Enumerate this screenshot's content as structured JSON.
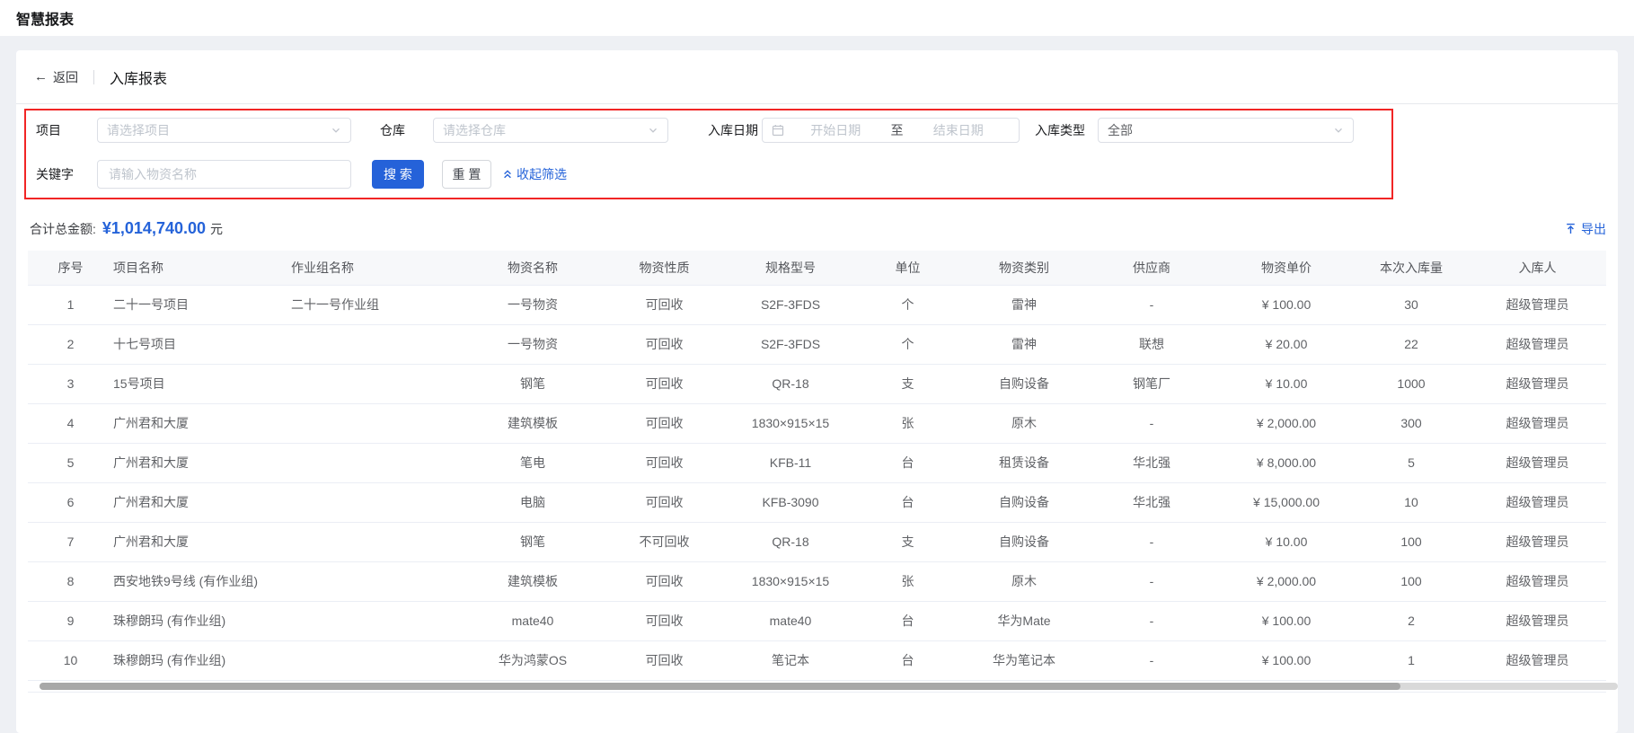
{
  "app": {
    "title": "智慧报表"
  },
  "page": {
    "back_label": "返回",
    "title": "入库报表"
  },
  "icons": {
    "back_arrow": "←"
  },
  "filters": {
    "project": {
      "label": "项目",
      "placeholder": "请选择项目"
    },
    "warehouse": {
      "label": "仓库",
      "placeholder": "请选择仓库"
    },
    "date": {
      "label": "入库日期",
      "start_placeholder": "开始日期",
      "separator": "至",
      "end_placeholder": "结束日期"
    },
    "type": {
      "label": "入库类型",
      "value": "全部"
    },
    "keyword": {
      "label": "关键字",
      "placeholder": "请输入物资名称"
    },
    "search_label": "搜 索",
    "reset_label": "重 置",
    "collapse_label": "收起筛选"
  },
  "summary": {
    "label": "合计总金额:",
    "amount": "¥1,014,740.00",
    "unit": "元",
    "export_label": "导出"
  },
  "colors": {
    "accent": "#2563d9",
    "highlight_border": "#f12525"
  },
  "table": {
    "columns": [
      "序号",
      "项目名称",
      "作业组名称",
      "物资名称",
      "物资性质",
      "规格型号",
      "单位",
      "物资类别",
      "供应商",
      "物资单价",
      "本次入库量",
      "入库人"
    ],
    "rows": [
      [
        "1",
        "二十一号项目",
        "二十一号作业组",
        "一号物资",
        "可回收",
        "S2F-3FDS",
        "个",
        "雷神",
        "-",
        "¥ 100.00",
        "30",
        "超级管理员"
      ],
      [
        "2",
        "十七号项目",
        "",
        "一号物资",
        "可回收",
        "S2F-3FDS",
        "个",
        "雷神",
        "联想",
        "¥ 20.00",
        "22",
        "超级管理员"
      ],
      [
        "3",
        "15号项目",
        "",
        "钢笔",
        "可回收",
        "QR-18",
        "支",
        "自购设备",
        "钢笔厂",
        "¥ 10.00",
        "1000",
        "超级管理员"
      ],
      [
        "4",
        "广州君和大厦",
        "",
        "建筑模板",
        "可回收",
        "1830×915×15",
        "张",
        "原木",
        "-",
        "¥ 2,000.00",
        "300",
        "超级管理员"
      ],
      [
        "5",
        "广州君和大厦",
        "",
        "笔电",
        "可回收",
        "KFB-11",
        "台",
        "租赁设备",
        "华北强",
        "¥ 8,000.00",
        "5",
        "超级管理员"
      ],
      [
        "6",
        "广州君和大厦",
        "",
        "电脑",
        "可回收",
        "KFB-3090",
        "台",
        "自购设备",
        "华北强",
        "¥ 15,000.00",
        "10",
        "超级管理员"
      ],
      [
        "7",
        "广州君和大厦",
        "",
        "钢笔",
        "不可回收",
        "QR-18",
        "支",
        "自购设备",
        "-",
        "¥ 10.00",
        "100",
        "超级管理员"
      ],
      [
        "8",
        "西安地铁9号线 (有作业组)",
        "",
        "建筑模板",
        "可回收",
        "1830×915×15",
        "张",
        "原木",
        "-",
        "¥ 2,000.00",
        "100",
        "超级管理员"
      ],
      [
        "9",
        "珠穆朗玛 (有作业组)",
        "",
        "mate40",
        "可回收",
        "mate40",
        "台",
        "华为Mate",
        "-",
        "¥ 100.00",
        "2",
        "超级管理员"
      ],
      [
        "10",
        "珠穆朗玛 (有作业组)",
        "",
        "华为鸿蒙OS",
        "可回收",
        "笔记本",
        "台",
        "华为笔记本",
        "-",
        "¥ 100.00",
        "1",
        "超级管理员"
      ]
    ]
  }
}
